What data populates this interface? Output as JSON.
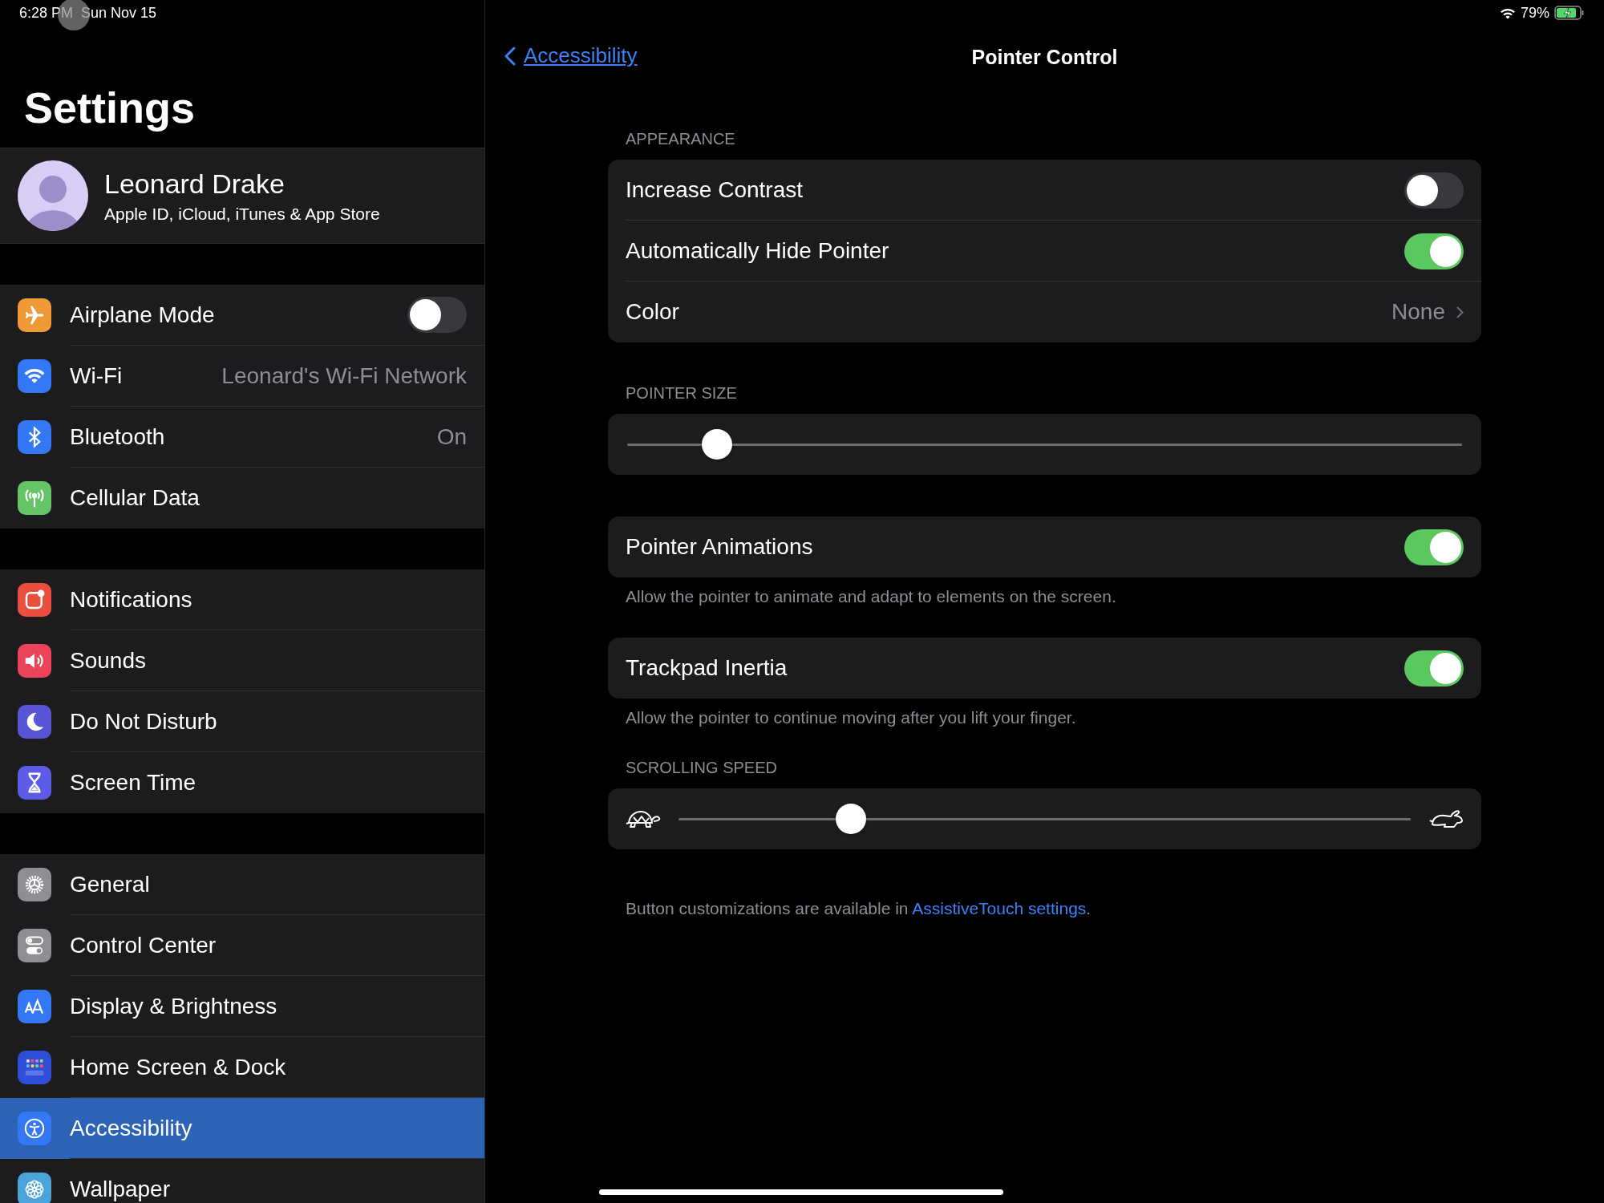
{
  "status_bar": {
    "time": "6:28 PM",
    "date": "Sun Nov 15",
    "battery": "79%"
  },
  "sidebar": {
    "title": "Settings",
    "profile": {
      "name": "Leonard Drake",
      "subtitle": "Apple ID, iCloud, iTunes & App Store"
    },
    "groups": [
      [
        {
          "label": "Airplane Mode",
          "kind": "toggle",
          "on": false,
          "selected": false,
          "color": "#f09a37"
        },
        {
          "label": "Wi-Fi",
          "kind": "value",
          "value": "Leonard's Wi-Fi Network",
          "selected": false,
          "color": "#3478f6"
        },
        {
          "label": "Bluetooth",
          "kind": "value",
          "value": "On",
          "selected": false,
          "color": "#3478f6"
        },
        {
          "label": "Cellular Data",
          "kind": "link",
          "selected": false,
          "color": "#65c466"
        }
      ],
      [
        {
          "label": "Notifications",
          "kind": "link",
          "selected": false,
          "color": "#eb4e3d"
        },
        {
          "label": "Sounds",
          "kind": "link",
          "selected": false,
          "color": "#eb445a"
        },
        {
          "label": "Do Not Disturb",
          "kind": "link",
          "selected": false,
          "color": "#5856d6"
        },
        {
          "label": "Screen Time",
          "kind": "link",
          "selected": false,
          "color": "#5e5ce6"
        }
      ],
      [
        {
          "label": "General",
          "kind": "link",
          "selected": false,
          "color": "#8e8e93"
        },
        {
          "label": "Control Center",
          "kind": "link",
          "selected": false,
          "color": "#8e8e93"
        },
        {
          "label": "Display & Brightness",
          "kind": "link",
          "selected": false,
          "color": "#3478f6"
        },
        {
          "label": "Home Screen & Dock",
          "kind": "link",
          "selected": false,
          "color": "#2f4fd8"
        },
        {
          "label": "Accessibility",
          "kind": "link",
          "selected": true,
          "color": "#3478f6"
        },
        {
          "label": "Wallpaper",
          "kind": "link",
          "selected": false,
          "color": "#4aa3d9"
        }
      ]
    ]
  },
  "detail": {
    "back": "Accessibility",
    "title": "Pointer Control",
    "sections": [
      {
        "header": "APPEARANCE",
        "rows": [
          {
            "kind": "toggle",
            "label": "Increase Contrast",
            "on": false
          },
          {
            "kind": "toggle",
            "label": "Automatically Hide Pointer",
            "on": true
          },
          {
            "kind": "value",
            "label": "Color",
            "value": "None"
          }
        ]
      },
      {
        "header": "POINTER SIZE",
        "rows": [
          {
            "kind": "slider",
            "level": 0.108
          }
        ]
      },
      {
        "rows": [
          {
            "kind": "toggle",
            "label": "Pointer Animations",
            "on": true
          }
        ],
        "footer": "Allow the pointer to animate and adapt to elements on the screen."
      },
      {
        "rows": [
          {
            "kind": "toggle",
            "label": "Trackpad Inertia",
            "on": true
          }
        ],
        "footer": "Allow the pointer to continue moving after you lift your finger."
      },
      {
        "header": "SCROLLING SPEED",
        "rows": [
          {
            "kind": "speed-slider",
            "level": 0.236
          }
        ]
      }
    ],
    "note": {
      "text": "Button customizations are available in ",
      "link": "AssistiveTouch settings",
      "tail": "."
    }
  }
}
